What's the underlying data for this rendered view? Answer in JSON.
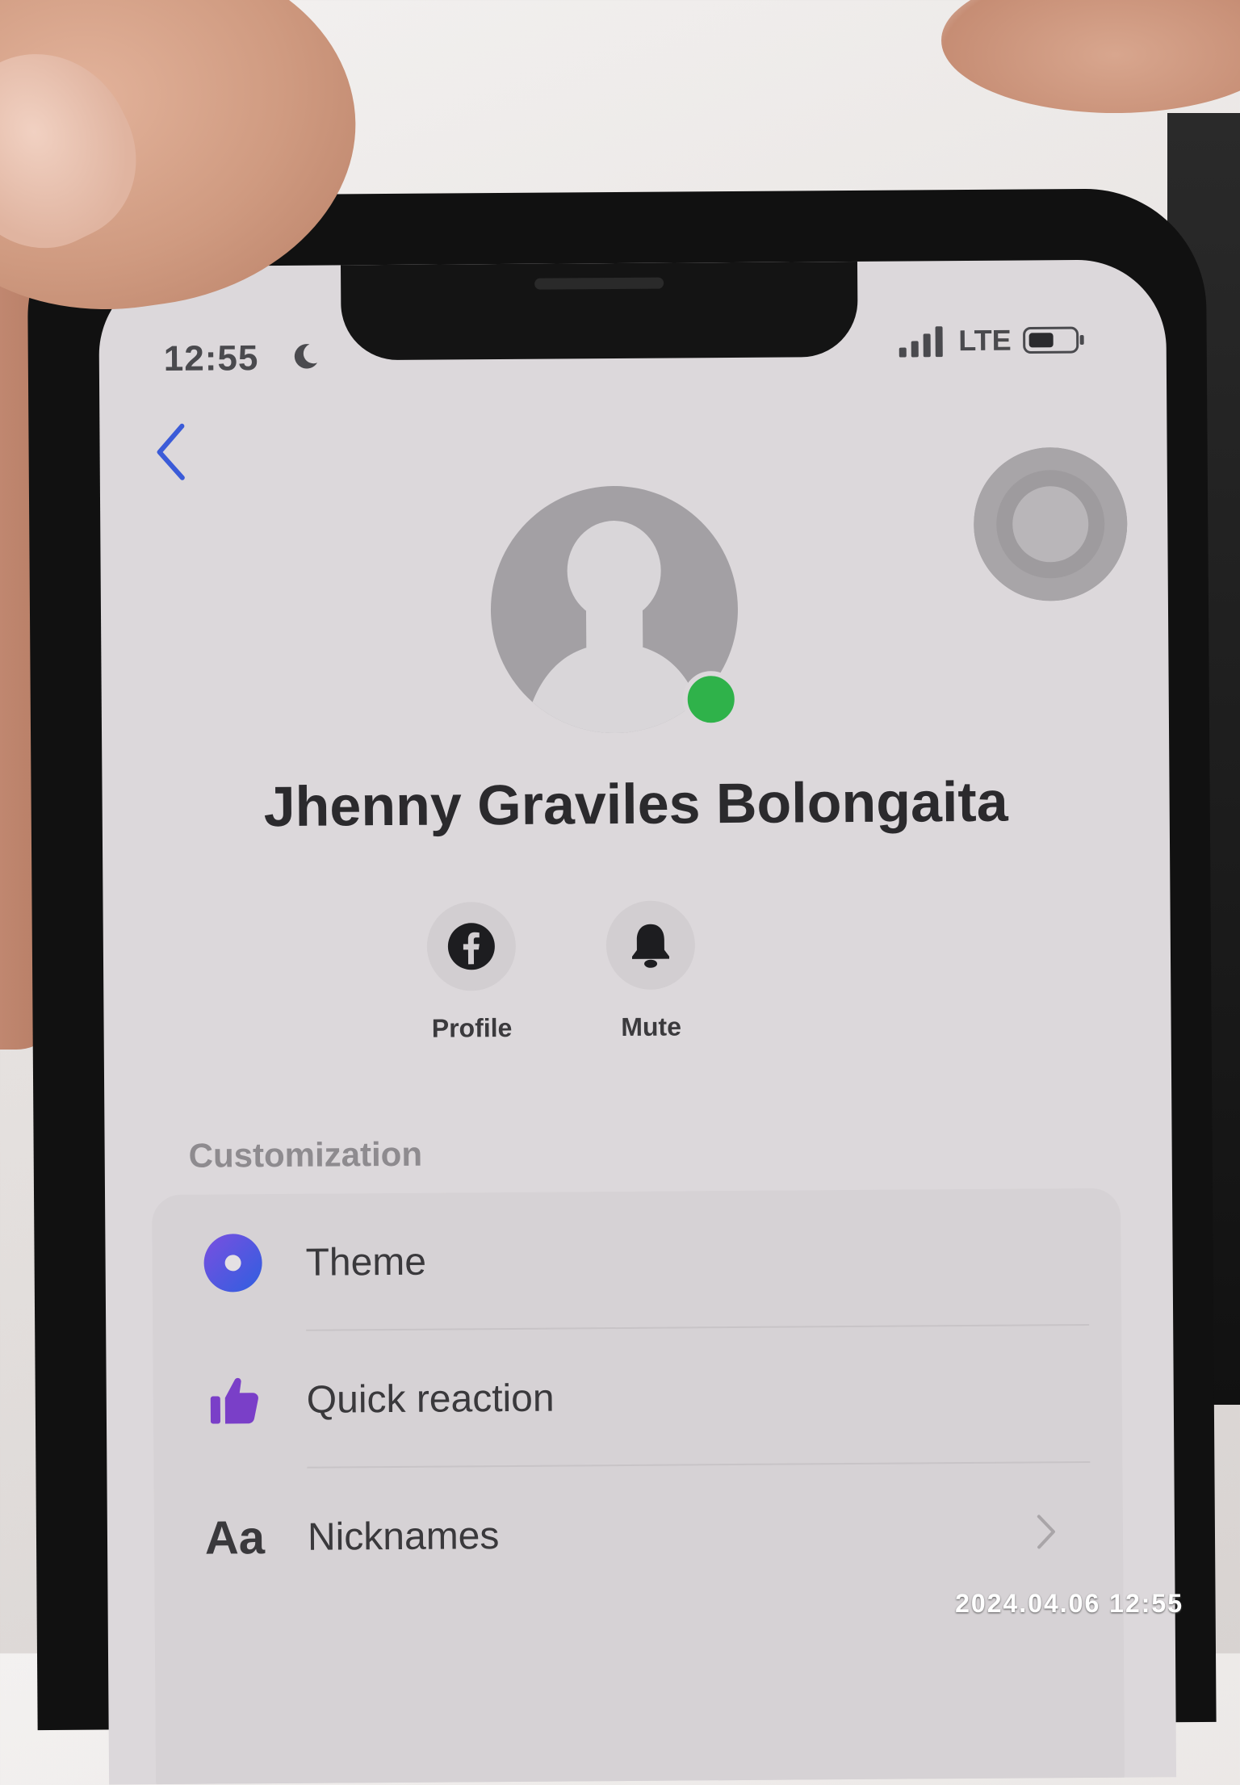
{
  "status_bar": {
    "time": "12:55",
    "network": "LTE"
  },
  "contact": {
    "name": "Jhenny Graviles Bolongaita",
    "online": true
  },
  "actions": [
    {
      "label": "Profile",
      "icon": "facebook-icon"
    },
    {
      "label": "Mute",
      "icon": "bell-icon"
    }
  ],
  "customization": {
    "title": "Customization",
    "items": [
      {
        "label": "Theme",
        "icon": "theme-icon"
      },
      {
        "label": "Quick reaction",
        "icon": "thumbs-up-icon"
      },
      {
        "label": "Nicknames",
        "icon": "nicknames-icon",
        "icon_text": "Aa"
      }
    ]
  },
  "photo_timestamp": "2024.04.06 12:55",
  "colors": {
    "accent": "#3b5bd8",
    "theme_icon": "#5a4fd6",
    "reaction_icon": "#7a3fc8",
    "online": "#2fb24a"
  }
}
